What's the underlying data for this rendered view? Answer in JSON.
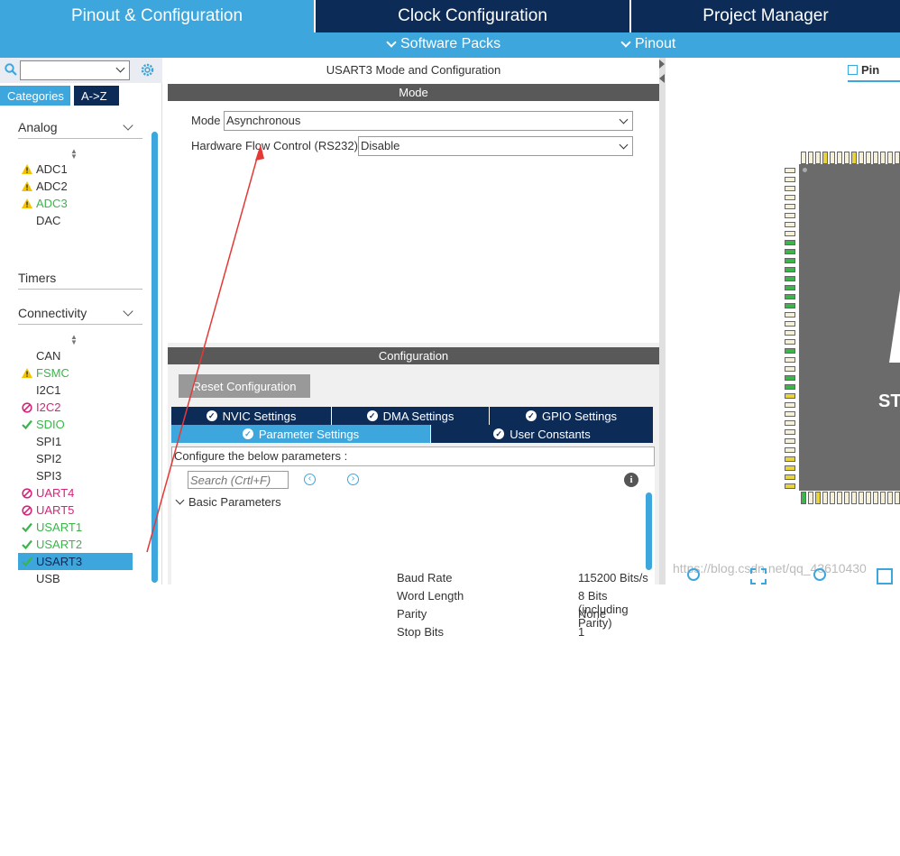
{
  "top_tabs": [
    "Pinout & Configuration",
    "Clock Configuration",
    "Project Manager"
  ],
  "sub_menu": [
    "Software Packs",
    "Pinout"
  ],
  "left": {
    "tabs": [
      "Categories",
      "A->Z"
    ],
    "sections": {
      "analog": "Analog",
      "timers": "Timers",
      "connectivity": "Connectivity"
    },
    "analog_items": [
      {
        "label": "ADC1",
        "icon": "warning",
        "color": "#333"
      },
      {
        "label": "ADC2",
        "icon": "warning",
        "color": "#333"
      },
      {
        "label": "ADC3",
        "icon": "warning",
        "color": "#3bb54a"
      },
      {
        "label": "DAC",
        "icon": "",
        "color": "#333"
      }
    ],
    "connectivity_items": [
      {
        "label": "CAN",
        "icon": "",
        "color": "#333"
      },
      {
        "label": "FSMC",
        "icon": "warning",
        "color": "#3bb54a"
      },
      {
        "label": "I2C1",
        "icon": "",
        "color": "#333"
      },
      {
        "label": "I2C2",
        "icon": "blocked",
        "color": "#d6247a"
      },
      {
        "label": "SDIO",
        "icon": "check",
        "color": "#3bb54a"
      },
      {
        "label": "SPI1",
        "icon": "",
        "color": "#333"
      },
      {
        "label": "SPI2",
        "icon": "",
        "color": "#333"
      },
      {
        "label": "SPI3",
        "icon": "",
        "color": "#333"
      },
      {
        "label": "UART4",
        "icon": "blocked",
        "color": "#d6247a"
      },
      {
        "label": "UART5",
        "icon": "blocked",
        "color": "#d6247a"
      },
      {
        "label": "USART1",
        "icon": "check",
        "color": "#3bb54a"
      },
      {
        "label": "USART2",
        "icon": "check",
        "color": "#3bb54a"
      },
      {
        "label": "USART3",
        "icon": "check",
        "color": "#ffffff"
      },
      {
        "label": "USB",
        "icon": "",
        "color": "#333"
      }
    ]
  },
  "mode_panel": {
    "title": "USART3 Mode and Configuration",
    "mode_header": "Mode",
    "mode_label": "Mode",
    "mode_value": "Asynchronous",
    "flow_label": "Hardware Flow Control (RS232)",
    "flow_value": "Disable"
  },
  "config_panel": {
    "header": "Configuration",
    "reset_button": "Reset Configuration",
    "tabs_row1": [
      "NVIC Settings",
      "DMA Settings",
      "GPIO Settings"
    ],
    "tabs_row2": [
      "Parameter Settings",
      "User Constants"
    ],
    "configure_text": "Configure the below parameters :",
    "search_placeholder": "Search (Crtl+F)",
    "group_title": "Basic Parameters",
    "params": [
      {
        "name": "Baud Rate",
        "value": "115200 Bits/s"
      },
      {
        "name": "Word Length",
        "value": "8 Bits (including Parity)"
      },
      {
        "name": "Parity",
        "value": "None"
      },
      {
        "name": "Stop Bits",
        "value": "1"
      }
    ]
  },
  "right": {
    "tab_label": "Pin",
    "chip_text": "ST",
    "watermark": "https://blog.csdn.net/qq_43610430"
  },
  "colors": {
    "navy": "#0d2b57",
    "accent": "#3ca6dd",
    "ok": "#3bb54a",
    "error": "#d6247a",
    "arrow": "#e53935"
  }
}
